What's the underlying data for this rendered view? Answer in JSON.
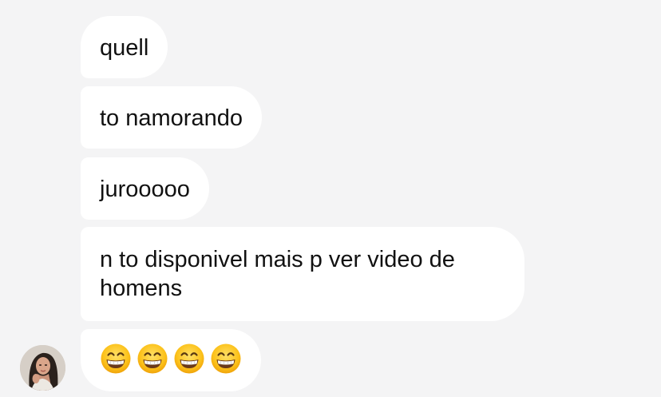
{
  "messages": [
    {
      "text": "quell"
    },
    {
      "text": "to namorando"
    },
    {
      "text": "jurooooo"
    },
    {
      "line1": "n to disponivel mais p ver video de",
      "line2": "homens"
    },
    {
      "emojis": [
        "grinning-face-with-smiling-eyes",
        "grinning-face-with-smiling-eyes",
        "grinning-face-with-smiling-eyes",
        "grinning-face-with-smiling-eyes"
      ]
    }
  ],
  "sender": {
    "avatar_icon": "profile-photo"
  },
  "colors": {
    "background": "#f4f4f5",
    "bubble": "#ffffff",
    "text": "#111111"
  }
}
